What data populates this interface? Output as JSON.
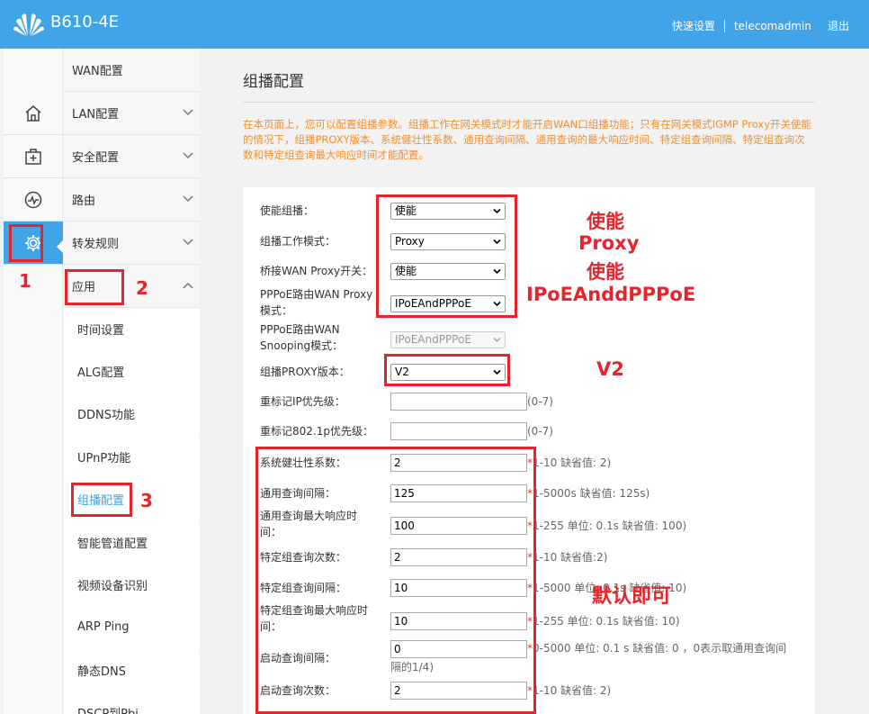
{
  "header": {
    "product": "B610-4E",
    "quick_setup": "快速设置",
    "username": "telecomadmin",
    "logout": "退出"
  },
  "menu": {
    "wan": "WAN配置",
    "lan": "LAN配置",
    "security": "安全配置",
    "route": "路由",
    "forward": "转发规则",
    "app": "应用"
  },
  "submenu": [
    "时间设置",
    "ALG配置",
    "DDNS功能",
    "UPnP功能",
    "组播配置",
    "智能管道配置",
    "视频设备识别",
    "ARP Ping",
    "静态DNS",
    "DSCP到Pbi"
  ],
  "page": {
    "title": "组播配置",
    "description": "在本页面上，您可以配置组播参数。组播工作在网关模式时才能开启WAN口组播功能；只有在网关模式IGMP Proxy开关使能的情况下，组播PROXY版本、系统健壮性系数、通用查询间隔、通用查询的最大响应时间、特定组查询间隔、特定组查询次数和特定组查询最大响应时间才能配置。"
  },
  "form": {
    "enable": {
      "label": "使能组播：",
      "value": "使能"
    },
    "mode": {
      "label": "组播工作模式：",
      "value": "Proxy"
    },
    "bridge": {
      "label": "桥接WAN Proxy开关：",
      "value": "使能"
    },
    "pppoe_proxy": {
      "label1": "PPPoE路由WAN Proxy",
      "label2": "模式：",
      "value": "IPoEAndPPPoE"
    },
    "pppoe_snoop": {
      "label1": "PPPoE路由WAN",
      "label2": "Snooping模式：",
      "value": "IPoEAndPPPoE"
    },
    "proxy_version": {
      "label": "组播PROXY版本：",
      "value": "V2"
    },
    "ip_priority": {
      "label": "重标记IP优先级：",
      "value": "",
      "hint": "(0-7)"
    },
    "dot1p_priority": {
      "label": "重标记802.1p优先级：",
      "value": "",
      "hint": "(0-7)"
    },
    "robustness": {
      "label": "系统健壮性系数：",
      "value": "2",
      "hint": "1-10 缺省值: 2)"
    },
    "query_interval": {
      "label": "通用查询间隔：",
      "value": "125",
      "hint": "1-5000s 缺省值: 125s)"
    },
    "query_max_resp": {
      "label1": "通用查询最大响应时",
      "label2": "间：",
      "value": "100",
      "hint": "1-255 单位: 0.1s 缺省值: 100)"
    },
    "spec_count": {
      "label": "特定组查询次数：",
      "value": "2",
      "hint": "1-10 缺省值:2)"
    },
    "spec_interval": {
      "label": "特定组查询间隔：",
      "value": "10",
      "hint": "1-5000 单位: 0.1s 缺省值: 10)"
    },
    "spec_max_resp": {
      "label1": "特定组查询最大响应时",
      "label2": "间：",
      "value": "10",
      "hint": "1-255 单位: 0.1s 缺省值: 10)"
    },
    "startup_interval": {
      "label": "启动查询间隔：",
      "value": "0",
      "hint": "0-5000 单位: 0.1 s 缺省值: 0 ，0表示取通用查询间",
      "hint2": "隔的1/4)"
    },
    "startup_count": {
      "label": "启动查询次数：",
      "value": "2",
      "hint": "1-10 缺省值: 2)"
    },
    "star": "*"
  },
  "annotations": {
    "n1": "1",
    "n2": "2",
    "n3": "3",
    "t_enable": "使能",
    "t_proxy": "Proxy",
    "t_enable2": "使能",
    "t_ipoe": "IPoEAnddPPPoE",
    "t_v2": "V2",
    "t_default": "默认即可"
  },
  "colors": {
    "header_bg": "#41a3e8",
    "annotation": "#e3262e",
    "description": "#f0902d"
  }
}
